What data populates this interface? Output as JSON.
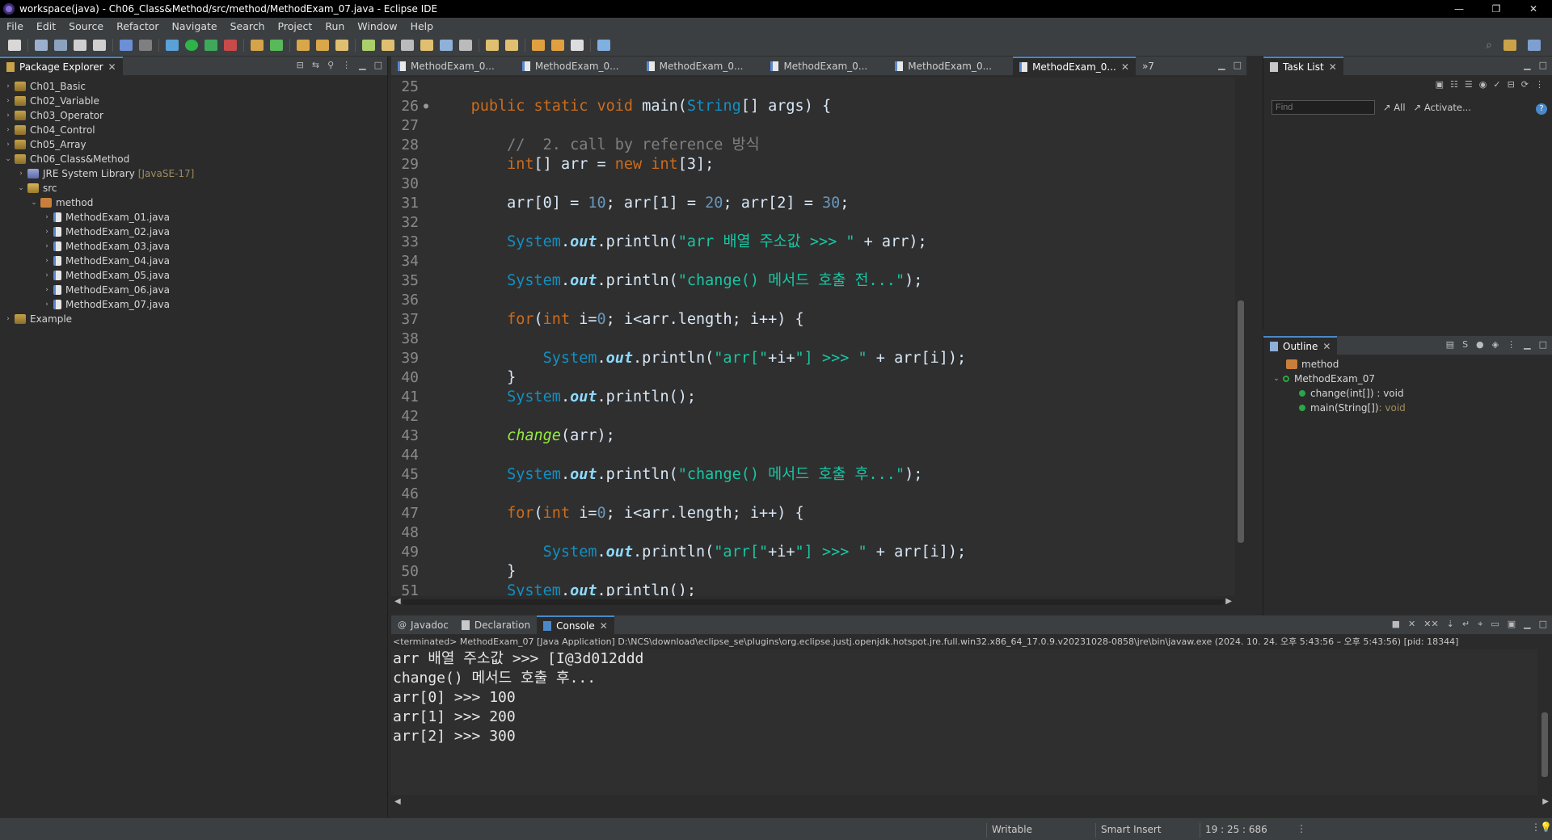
{
  "window": {
    "title": "workspace(java) - Ch06_Class&Method/src/method/MethodExam_07.java - Eclipse IDE",
    "controls": [
      "—",
      "❐",
      "✕"
    ]
  },
  "menu": [
    "File",
    "Edit",
    "Source",
    "Refactor",
    "Navigate",
    "Search",
    "Project",
    "Run",
    "Window",
    "Help"
  ],
  "package_explorer": {
    "title": "Package Explorer",
    "items": [
      {
        "label": "Ch01_Basic",
        "arrow": "›",
        "icon": "project-icon"
      },
      {
        "label": "Ch02_Variable",
        "arrow": "›",
        "icon": "project-icon"
      },
      {
        "label": "Ch03_Operator",
        "arrow": "›",
        "icon": "project-icon"
      },
      {
        "label": "Ch04_Control",
        "arrow": "›",
        "icon": "project-icon"
      },
      {
        "label": "Ch05_Array",
        "arrow": "›",
        "icon": "project-icon"
      },
      {
        "label": "Ch06_Class&Method",
        "arrow": "⌄",
        "icon": "project-icon"
      },
      {
        "label": "JRE System Library",
        "hint": "[JavaSE-17]",
        "arrow": "›",
        "icon": "library-icon"
      },
      {
        "label": "src",
        "arrow": "⌄",
        "icon": "source-folder-icon"
      },
      {
        "label": "method",
        "arrow": "⌄",
        "icon": "package-icon"
      },
      {
        "label": "MethodExam_01.java",
        "arrow": "›",
        "icon": "java-file-icon"
      },
      {
        "label": "MethodExam_02.java",
        "arrow": "›",
        "icon": "java-file-icon"
      },
      {
        "label": "MethodExam_03.java",
        "arrow": "›",
        "icon": "java-file-icon"
      },
      {
        "label": "MethodExam_04.java",
        "arrow": "›",
        "icon": "java-file-icon"
      },
      {
        "label": "MethodExam_05.java",
        "arrow": "›",
        "icon": "java-file-icon"
      },
      {
        "label": "MethodExam_06.java",
        "arrow": "›",
        "icon": "java-file-icon"
      },
      {
        "label": "MethodExam_07.java",
        "arrow": "›",
        "icon": "java-file-icon"
      },
      {
        "label": "Example",
        "arrow": "›",
        "icon": "project-icon"
      }
    ]
  },
  "editor": {
    "tabs": [
      "MethodExam_0...",
      "MethodExam_0...",
      "MethodExam_0...",
      "MethodExam_0...",
      "MethodExam_0...",
      "MethodExam_0..."
    ],
    "overflow": "»7",
    "line_numbers": [
      "25",
      "26",
      "27",
      "28",
      "29",
      "30",
      "31",
      "32",
      "33",
      "34",
      "35",
      "36",
      "37",
      "38",
      "39",
      "40",
      "41",
      "42",
      "43",
      "44",
      "45",
      "46",
      "47",
      "48",
      "49",
      "50",
      "51"
    ],
    "code": {
      "l26_a": "public",
      "l26_b": "static",
      "l26_c": "void",
      "l26_d": "main(",
      "l26_e": "String",
      "l26_f": "[] args) {",
      "l28": "//  2. call by reference 방식",
      "l29_a": "int",
      "l29_b": "[] arr = ",
      "l29_c": "new",
      "l29_d": "int",
      "l29_e": "[3];",
      "l31_a": "arr[0] = ",
      "l31_b": "10",
      "l31_c": "; arr[1] = ",
      "l31_d": "20",
      "l31_e": "; arr[2] = ",
      "l31_f": "30",
      "l31_g": ";",
      "sys": "System",
      "dot": ".",
      "out": "out",
      "println": ".println(",
      "l33_s": "\"arr 배열 주소값 >>> \"",
      "l33_r": " + arr);",
      "l35_s": "\"change() 메서드 호출 전...\"",
      "l35_r": ");",
      "l37_a": "for",
      "l37_b": "(",
      "l37_c": "int",
      "l37_d": " i=",
      "l37_e": "0",
      "l37_f": "; i<arr.length; i++) {",
      "l39_s1": "\"arr[\"",
      "l39_m": "+i+",
      "l39_s2": "\"] >>> \"",
      "l39_r": " + arr[i]);",
      "brace": "}",
      "l41_r": ".println();",
      "l43_a": "change",
      "l43_b": "(arr);",
      "l45_s": "\"change() 메서드 호출 후...\"",
      "l45_r": ");"
    }
  },
  "task_list": {
    "title": "Task List",
    "find_placeholder": "Find",
    "all_label": "All",
    "activate_label": "Activate..."
  },
  "outline": {
    "title": "Outline",
    "items": [
      {
        "label": "method"
      },
      {
        "label": "MethodExam_07"
      },
      {
        "label": "change(int[]) : void"
      },
      {
        "label": "main(String[])",
        "type": " : void"
      }
    ]
  },
  "bottom_tabs": {
    "javadoc": "Javadoc",
    "declaration": "Declaration",
    "console": "Console"
  },
  "console": {
    "info": "<terminated> MethodExam_07 [Java Application] D:\\NCS\\download\\eclipse_se\\plugins\\org.eclipse.justj.openjdk.hotspot.jre.full.win32.x86_64_17.0.9.v20231028-0858\\jre\\bin\\javaw.exe  (2024. 10. 24. 오후 5:43:56 – 오후 5:43:56) [pid: 18344]",
    "lines": [
      "arr 배열 주소값 >>> [I@3d012ddd",
      "change() 메서드 호출 후...",
      "arr[0] >>> 100",
      "arr[1] >>> 200",
      "arr[2] >>> 300"
    ]
  },
  "status": {
    "writable": "Writable",
    "insert_mode": "Smart Insert",
    "position": "19 : 25 : 686"
  }
}
